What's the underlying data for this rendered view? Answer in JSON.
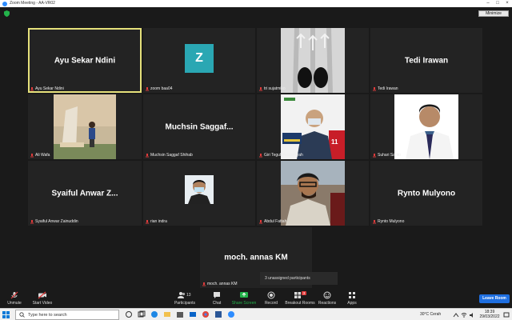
{
  "window": {
    "title": "Zoom Meeting - AA-VR02",
    "view_button": "Minimize"
  },
  "tiles": [
    {
      "big_name": "Ayu Sekar Ndini",
      "label": "Ayu Sekar Ndini"
    },
    {
      "avatar_letter": "Z",
      "label": "zoom baa04"
    },
    {
      "label": "tri sujatmiko"
    },
    {
      "big_name": "Tedi Irawan",
      "label": "Tedi Irawan"
    },
    {
      "label": "Ali Wafa"
    },
    {
      "big_name": "Muchsin  Saggaf...",
      "label": "Muchsin Saggaf Shihab"
    },
    {
      "label": "Giri Teguh Ardiansyah"
    },
    {
      "label": "Suhari Santo"
    },
    {
      "big_name": "Syaiful  Anwar  Z...",
      "label": "Syaiful Anwar Zainuddin"
    },
    {
      "label": "rian indra"
    },
    {
      "label": "Abdul Fattah"
    },
    {
      "big_name": "Rynto Mulyono",
      "label": "Rynto Mulyono"
    },
    {
      "big_name": "moch. annas KM",
      "label": "moch. annas KM"
    }
  ],
  "toast": "3 unassigned participants",
  "toolbar": {
    "unmute": "Unmute",
    "start_video": "Start Video",
    "participants": "Participants",
    "participants_count": "13",
    "chat": "Chat",
    "share_screen": "Share Screen",
    "record": "Record",
    "breakout_rooms": "Breakout Rooms",
    "breakout_badge": "3",
    "reactions": "Reactions",
    "apps": "Apps",
    "leave": "Leave Room"
  },
  "taskbar": {
    "search_placeholder": "Type here to search",
    "weather": "30°C  Cerah",
    "time": "18:39",
    "date": "29/03/2022"
  },
  "colors": {
    "accent": "#2d8cff",
    "share_green": "#23b44b",
    "leave_blue": "#1f6fe0",
    "active_speaker": "#e5e07a"
  }
}
